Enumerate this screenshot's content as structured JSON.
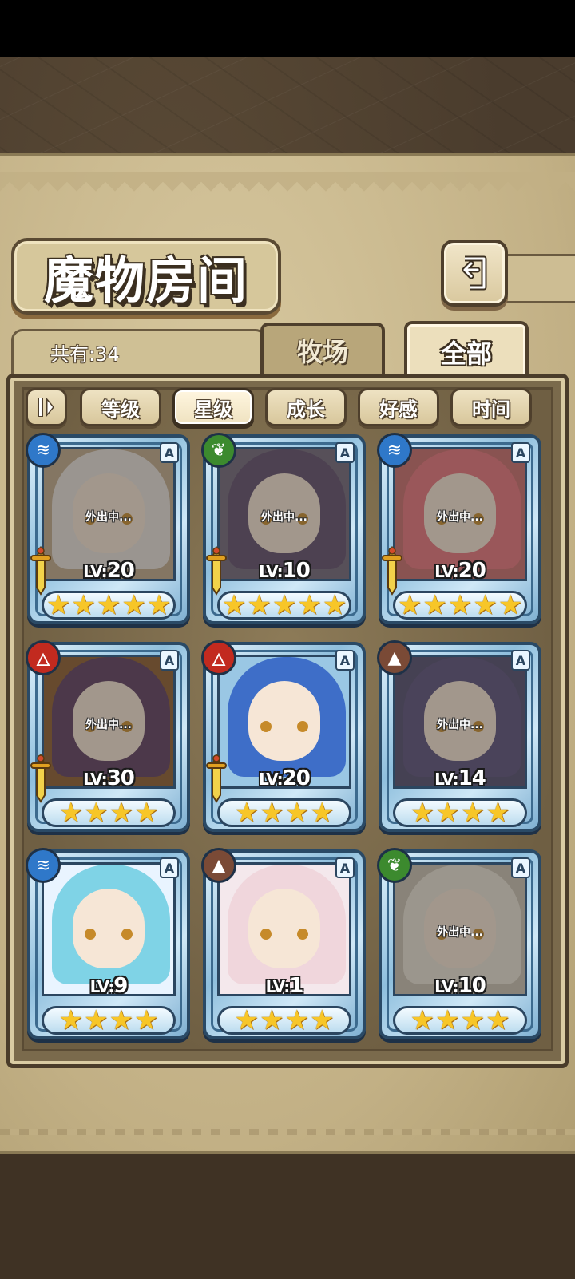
{
  "title": "魔物房间",
  "count_text": "共有:34",
  "tabs": {
    "ranch": "牧场",
    "all": "全部"
  },
  "sort": {
    "level": "等级",
    "stars": "星级",
    "growth": "成长",
    "affection": "好感",
    "time": "时间",
    "active": "stars"
  },
  "away_label": "外出中...",
  "rank_label": "A",
  "level_prefix": "LV:",
  "cards": [
    {
      "element": "water",
      "level": "20",
      "stars": 5,
      "away": true,
      "sword": true
    },
    {
      "element": "grass",
      "level": "10",
      "stars": 5,
      "away": true,
      "sword": true
    },
    {
      "element": "water",
      "level": "20",
      "stars": 5,
      "away": true,
      "sword": true
    },
    {
      "element": "fire",
      "level": "30",
      "stars": 4,
      "away": true,
      "sword": true
    },
    {
      "element": "fire",
      "level": "20",
      "stars": 4,
      "away": false,
      "sword": true
    },
    {
      "element": "earth",
      "level": "14",
      "stars": 4,
      "away": true,
      "sword": false
    },
    {
      "element": "water",
      "level": "9",
      "stars": 4,
      "away": false,
      "sword": false
    },
    {
      "element": "earth",
      "level": "1",
      "stars": 4,
      "away": false,
      "sword": false
    },
    {
      "element": "grass",
      "level": "10",
      "stars": 4,
      "away": true,
      "sword": false
    }
  ],
  "colors": {
    "parchment": "#c2b085",
    "panel": "#7a6a4c",
    "card_frame": "#8fbfdd",
    "star": "#f7c628",
    "water": "#2f78c9",
    "grass": "#3c8a2e",
    "fire": "#c22a1f",
    "earth": "#7a4a36"
  },
  "icons": {
    "back": "return-arrow-icon",
    "sort_toggle": "sort-order-icon",
    "water": "water-waves-icon",
    "grass": "leaf-icon",
    "fire": "flame-icon",
    "earth": "mountain-icon",
    "sword": "sword-icon",
    "star": "star-icon"
  }
}
